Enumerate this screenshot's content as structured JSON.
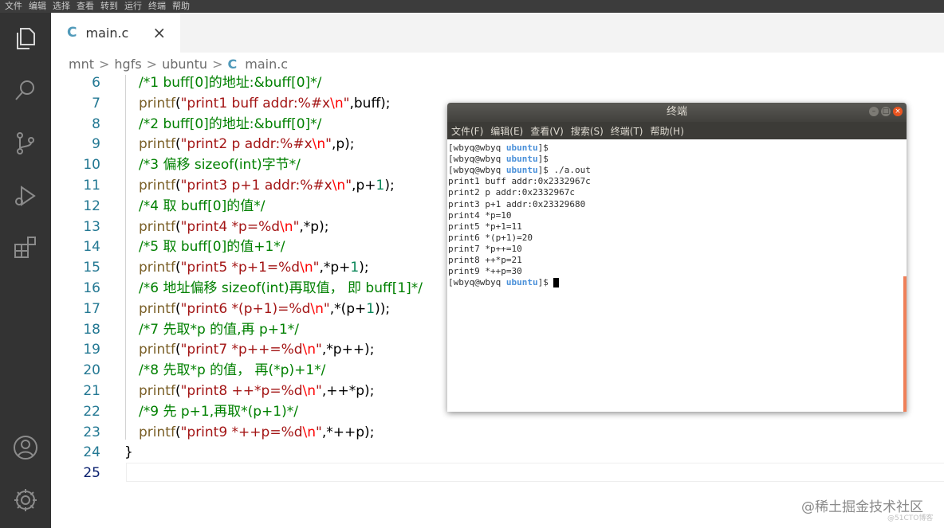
{
  "menubar": [
    "文件",
    "编辑",
    "选择",
    "查看",
    "转到",
    "运行",
    "终端",
    "帮助"
  ],
  "activity_icons": [
    "files-icon",
    "search-icon",
    "source-control-icon",
    "run-debug-icon",
    "extensions-icon",
    "account-icon",
    "gear-icon"
  ],
  "tab": {
    "label": "main.c",
    "close": "×",
    "lang_icon": "C"
  },
  "breadcrumb": {
    "parts": [
      "mnt",
      "hgfs",
      "ubuntu"
    ],
    "file": "main.c",
    "sep": ">"
  },
  "editor": {
    "lines": [
      {
        "n": "6",
        "tokens": [
          [
            "comment",
            "/*1 buff[0]的地址:&buff[0]*/"
          ]
        ]
      },
      {
        "n": "7",
        "tokens": [
          [
            "fn",
            "printf"
          ],
          [
            "plain",
            "("
          ],
          [
            "str",
            "\"print1 buff addr:%#x"
          ],
          [
            "esc",
            "\\n"
          ],
          [
            "str",
            "\""
          ],
          [
            "plain",
            ",buff);"
          ]
        ]
      },
      {
        "n": "8",
        "tokens": [
          [
            "comment",
            "/*2 buff[0]的地址:&buff[0]*/"
          ]
        ]
      },
      {
        "n": "9",
        "tokens": [
          [
            "fn",
            "printf"
          ],
          [
            "plain",
            "("
          ],
          [
            "str",
            "\"print2 p addr:%#x"
          ],
          [
            "esc",
            "\\n"
          ],
          [
            "str",
            "\""
          ],
          [
            "plain",
            ",p);"
          ]
        ]
      },
      {
        "n": "10",
        "tokens": [
          [
            "comment",
            "/*3 偏移 sizeof(int)字节*/"
          ]
        ]
      },
      {
        "n": "11",
        "tokens": [
          [
            "fn",
            "printf"
          ],
          [
            "plain",
            "("
          ],
          [
            "str",
            "\"print3 p+1 addr:%#x"
          ],
          [
            "esc",
            "\\n"
          ],
          [
            "str",
            "\""
          ],
          [
            "plain",
            ",p+"
          ],
          [
            "num",
            "1"
          ],
          [
            "plain",
            ");"
          ]
        ]
      },
      {
        "n": "12",
        "tokens": [
          [
            "comment",
            "/*4 取 buff[0]的值*/"
          ]
        ]
      },
      {
        "n": "13",
        "tokens": [
          [
            "fn",
            "printf"
          ],
          [
            "plain",
            "("
          ],
          [
            "str",
            "\"print4 *p=%d"
          ],
          [
            "esc",
            "\\n"
          ],
          [
            "str",
            "\""
          ],
          [
            "plain",
            ",*p);"
          ]
        ]
      },
      {
        "n": "14",
        "tokens": [
          [
            "comment",
            "/*5 取 buff[0]的值+1*/"
          ]
        ]
      },
      {
        "n": "15",
        "tokens": [
          [
            "fn",
            "printf"
          ],
          [
            "plain",
            "("
          ],
          [
            "str",
            "\"print5 *p+1=%d"
          ],
          [
            "esc",
            "\\n"
          ],
          [
            "str",
            "\""
          ],
          [
            "plain",
            ",*p+"
          ],
          [
            "num",
            "1"
          ],
          [
            "plain",
            ");"
          ]
        ]
      },
      {
        "n": "16",
        "tokens": [
          [
            "comment",
            "/*6 地址偏移 sizeof(int)再取值， 即 buff[1]*/"
          ]
        ]
      },
      {
        "n": "17",
        "tokens": [
          [
            "fn",
            "printf"
          ],
          [
            "plain",
            "("
          ],
          [
            "str",
            "\"print6 *(p+1)=%d"
          ],
          [
            "esc",
            "\\n"
          ],
          [
            "str",
            "\""
          ],
          [
            "plain",
            ",*(p+"
          ],
          [
            "num",
            "1"
          ],
          [
            "plain",
            "));"
          ]
        ]
      },
      {
        "n": "18",
        "tokens": [
          [
            "comment",
            "/*7 先取*p 的值,再 p+1*/"
          ]
        ]
      },
      {
        "n": "19",
        "tokens": [
          [
            "fn",
            "printf"
          ],
          [
            "plain",
            "("
          ],
          [
            "str",
            "\"print7 *p++=%d"
          ],
          [
            "esc",
            "\\n"
          ],
          [
            "str",
            "\""
          ],
          [
            "plain",
            ",*p++);"
          ]
        ]
      },
      {
        "n": "20",
        "tokens": [
          [
            "comment",
            "/*8 先取*p 的值， 再(*p)+1*/"
          ]
        ]
      },
      {
        "n": "21",
        "tokens": [
          [
            "fn",
            "printf"
          ],
          [
            "plain",
            "("
          ],
          [
            "str",
            "\"print8 ++*p=%d"
          ],
          [
            "esc",
            "\\n"
          ],
          [
            "str",
            "\""
          ],
          [
            "plain",
            ",++*p);"
          ]
        ]
      },
      {
        "n": "22",
        "tokens": [
          [
            "comment",
            "/*9 先 p+1,再取*(p+1)*/"
          ]
        ]
      },
      {
        "n": "23",
        "tokens": [
          [
            "fn",
            "printf"
          ],
          [
            "plain",
            "("
          ],
          [
            "str",
            "\"print9 *++p=%d"
          ],
          [
            "esc",
            "\\n"
          ],
          [
            "str",
            "\""
          ],
          [
            "plain",
            ",*++p);"
          ]
        ]
      },
      {
        "n": "24",
        "tokens": [
          [
            "plain",
            "}"
          ]
        ]
      },
      {
        "n": "25",
        "tokens": []
      }
    ]
  },
  "terminal": {
    "title": "终端",
    "window_buttons": {
      "min": "–",
      "max": "□",
      "close": "×"
    },
    "menu": [
      "文件(F)",
      "编辑(E)",
      "查看(V)",
      "搜索(S)",
      "终端(T)",
      "帮助(H)"
    ],
    "prompt_user": "[wbyq@wbyq",
    "prompt_dir": "ubuntu",
    "prompt_end": "]$",
    "lines": [
      {
        "type": "prompt",
        "cmd": ""
      },
      {
        "type": "prompt",
        "cmd": ""
      },
      {
        "type": "prompt",
        "cmd": " ./a.out"
      },
      {
        "type": "out",
        "text": "print1 buff addr:0x2332967c"
      },
      {
        "type": "out",
        "text": "print2 p addr:0x2332967c"
      },
      {
        "type": "out",
        "text": "print3 p+1 addr:0x23329680"
      },
      {
        "type": "out",
        "text": "print4 *p=10"
      },
      {
        "type": "out",
        "text": "print5 *p+1=11"
      },
      {
        "type": "out",
        "text": "print6 *(p+1)=20"
      },
      {
        "type": "out",
        "text": "print7 *p++=10"
      },
      {
        "type": "out",
        "text": "print8 ++*p=21"
      },
      {
        "type": "out",
        "text": "print9 *++p=30"
      },
      {
        "type": "prompt_cursor",
        "cmd": " "
      }
    ]
  },
  "watermark": {
    "main": "@稀土掘金技术社区",
    "sub": "@51CTO博客"
  }
}
